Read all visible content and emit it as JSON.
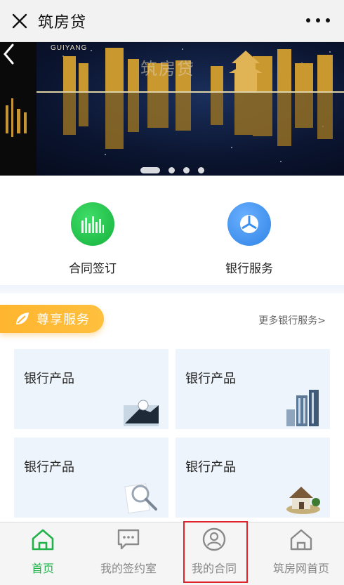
{
  "header": {
    "title": "筑房贷",
    "close_icon": "close-icon",
    "more_icon": "more-dots-icon"
  },
  "banner": {
    "brand_text": "GUIYANG",
    "overlay_text": "筑房贷",
    "slide_count": 4,
    "active_slide": 1
  },
  "quick_services": [
    {
      "label": "合同签订",
      "icon": "chart-bars-icon",
      "color": "#22c04a"
    },
    {
      "label": "银行服务",
      "icon": "pie-chart-icon",
      "color": "#3a8ff0"
    }
  ],
  "section": {
    "title": "尊享服务",
    "more_link": "更多银行服务>"
  },
  "products": [
    {
      "label": "银行产品",
      "icon": "handshake-icon"
    },
    {
      "label": "银行产品",
      "icon": "buildings-icon"
    },
    {
      "label": "银行产品",
      "icon": "magnifier-icon"
    },
    {
      "label": "银行产品",
      "icon": "house-icon"
    }
  ],
  "tabs": [
    {
      "label": "首页",
      "icon": "home-icon",
      "active": true
    },
    {
      "label": "我的签约室",
      "icon": "chat-icon",
      "active": false
    },
    {
      "label": "我的合同",
      "icon": "user-circle-icon",
      "active": false
    },
    {
      "label": "筑房网首页",
      "icon": "home-outline-icon",
      "active": false
    }
  ],
  "colors": {
    "accent_green": "#21b24a",
    "badge_orange": "#ffb52e",
    "highlight_red": "#e0232b"
  }
}
